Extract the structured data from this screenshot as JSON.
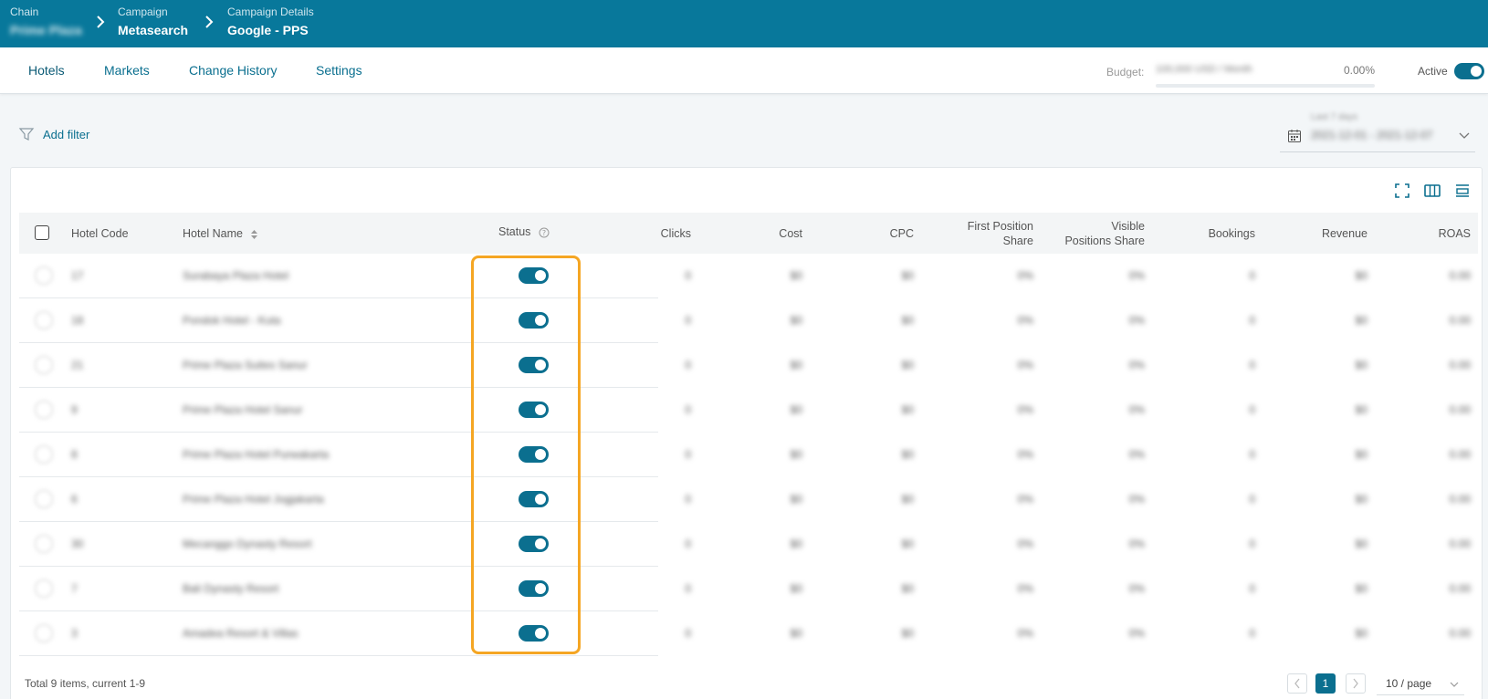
{
  "header": {
    "crumbs": [
      {
        "label": "Chain",
        "value": "Prime Plaza"
      },
      {
        "label": "Campaign",
        "value": "Metasearch"
      },
      {
        "label": "Campaign Details",
        "value": "Google - PPS"
      }
    ]
  },
  "tabs": [
    "Hotels",
    "Markets",
    "Change History",
    "Settings"
  ],
  "budget": {
    "label": "Budget:",
    "amount": "100,000 USD / Month",
    "percent": "0.00%"
  },
  "active_label": "Active",
  "filter": {
    "label": "Add filter"
  },
  "date_range": {
    "label": "Last 7 days",
    "value": "2021-12-01 - 2021-12-07"
  },
  "table": {
    "columns": {
      "hotel_code": "Hotel Code",
      "hotel_name": "Hotel Name",
      "status": "Status",
      "clicks": "Clicks",
      "cost": "Cost",
      "cpc": "CPC",
      "first_position_share_1": "First Position",
      "first_position_share_2": "Share",
      "visible_positions_share_1": "Visible",
      "visible_positions_share_2": "Positions Share",
      "bookings": "Bookings",
      "revenue": "Revenue",
      "roas": "ROAS"
    },
    "rows": [
      {
        "code": "17",
        "name": "Surabaya Plaza Hotel",
        "clicks": "0",
        "cost": "$0",
        "cpc": "$0",
        "fps": "0%",
        "vps": "0%",
        "bookings": "0",
        "revenue": "$0",
        "roas": "0.00"
      },
      {
        "code": "18",
        "name": "Pondok Hotel - Kuta",
        "clicks": "0",
        "cost": "$0",
        "cpc": "$0",
        "fps": "0%",
        "vps": "0%",
        "bookings": "0",
        "revenue": "$0",
        "roas": "0.00"
      },
      {
        "code": "21",
        "name": "Prime Plaza Suites Sanur",
        "clicks": "0",
        "cost": "$0",
        "cpc": "$0",
        "fps": "0%",
        "vps": "0%",
        "bookings": "0",
        "revenue": "$0",
        "roas": "0.00"
      },
      {
        "code": "9",
        "name": "Prime Plaza Hotel Sanur",
        "clicks": "0",
        "cost": "$0",
        "cpc": "$0",
        "fps": "0%",
        "vps": "0%",
        "bookings": "0",
        "revenue": "$0",
        "roas": "0.00"
      },
      {
        "code": "8",
        "name": "Prime Plaza Hotel Purwakarta",
        "clicks": "0",
        "cost": "$0",
        "cpc": "$0",
        "fps": "0%",
        "vps": "0%",
        "bookings": "0",
        "revenue": "$0",
        "roas": "0.00"
      },
      {
        "code": "6",
        "name": "Prime Plaza Hotel Jogjakarta",
        "clicks": "0",
        "cost": "$0",
        "cpc": "$0",
        "fps": "0%",
        "vps": "0%",
        "bookings": "0",
        "revenue": "$0",
        "roas": "0.00"
      },
      {
        "code": "30",
        "name": "Mecanggo Dynasty Resort",
        "clicks": "0",
        "cost": "$0",
        "cpc": "$0",
        "fps": "0%",
        "vps": "0%",
        "bookings": "0",
        "revenue": "$0",
        "roas": "0.00"
      },
      {
        "code": "7",
        "name": "Bali Dynasty Resort",
        "clicks": "0",
        "cost": "$0",
        "cpc": "$0",
        "fps": "0%",
        "vps": "0%",
        "bookings": "0",
        "revenue": "$0",
        "roas": "0.00"
      },
      {
        "code": "3",
        "name": "Amadea Resort & Villas",
        "clicks": "0",
        "cost": "$0",
        "cpc": "$0",
        "fps": "0%",
        "vps": "0%",
        "bookings": "0",
        "revenue": "$0",
        "roas": "0.00"
      }
    ]
  },
  "pagination": {
    "total": "Total 9 items, current 1-9",
    "current_page": "1",
    "per_page": "10 / page"
  },
  "colors": {
    "header_bg": "#08789b",
    "accent": "#0b6f8f",
    "highlight": "#f5a623"
  }
}
